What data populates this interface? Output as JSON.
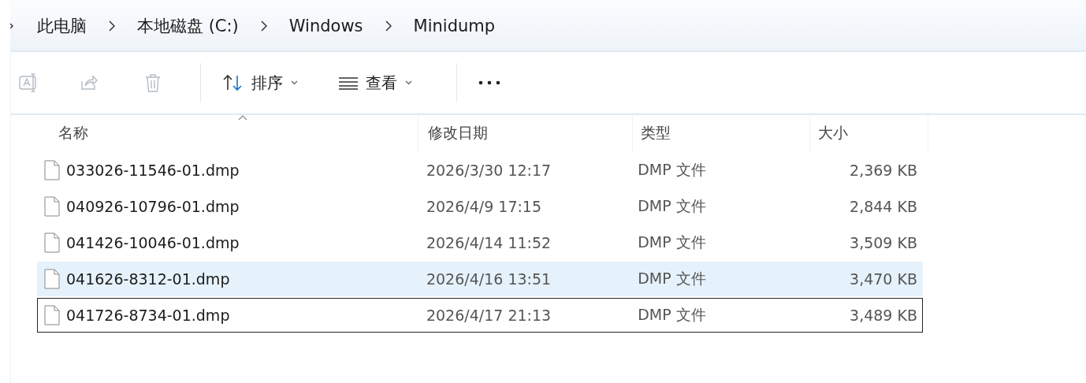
{
  "breadcrumb": [
    {
      "label": "此电脑"
    },
    {
      "label": "本地磁盘 (C:)"
    },
    {
      "label": "Windows"
    },
    {
      "label": "Minidump"
    }
  ],
  "toolbar": {
    "buttons": [
      {
        "kind": "rename",
        "disabled": true
      },
      {
        "kind": "share",
        "disabled": true
      },
      {
        "kind": "delete",
        "disabled": true
      }
    ],
    "sort": {
      "label": "排序"
    },
    "view": {
      "label": "查看"
    }
  },
  "table": {
    "columns": [
      {
        "label": "名称",
        "sorted": true
      },
      {
        "label": "修改日期",
        "sorted": false
      },
      {
        "label": "类型",
        "sorted": false
      },
      {
        "label": "大小",
        "sorted": false
      }
    ],
    "rows": [
      {
        "name": "033026-11546-01.dmp",
        "date": "2026/3/30 12:17",
        "type": "DMP 文件",
        "size": "2,369 KB",
        "highlighted": false,
        "focused": false
      },
      {
        "name": "040926-10796-01.dmp",
        "date": "2026/4/9 17:15",
        "type": "DMP 文件",
        "size": "2,844 KB",
        "highlighted": false,
        "focused": false
      },
      {
        "name": "041426-10046-01.dmp",
        "date": "2026/4/14 11:52",
        "type": "DMP 文件",
        "size": "3,509 KB",
        "highlighted": false,
        "focused": false
      },
      {
        "name": "041626-8312-01.dmp",
        "date": "2026/4/16 13:51",
        "type": "DMP 文件",
        "size": "3,470 KB",
        "highlighted": true,
        "focused": false
      },
      {
        "name": "041726-8734-01.dmp",
        "date": "2026/4/17 21:13",
        "type": "DMP 文件",
        "size": "3,489 KB",
        "highlighted": false,
        "focused": true
      }
    ]
  }
}
